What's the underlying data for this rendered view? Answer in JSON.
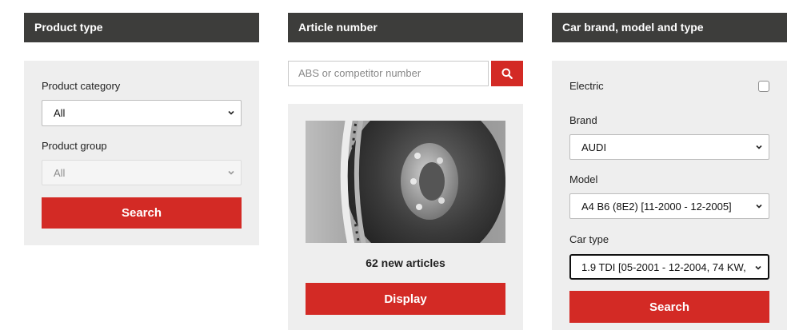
{
  "product_type": {
    "title": "Product type",
    "category_label": "Product category",
    "category_value": "All",
    "group_label": "Product group",
    "group_value": "All",
    "search_label": "Search"
  },
  "article_number": {
    "title": "Article number",
    "search_placeholder": "ABS or competitor number",
    "new_articles_text": "62 new articles",
    "display_label": "Display"
  },
  "car": {
    "title": "Car brand, model and type",
    "electric_label": "Electric",
    "electric_checked": false,
    "brand_label": "Brand",
    "brand_value": "AUDI",
    "model_label": "Model",
    "model_value": "A4 B6 (8E2) [11-2000 - 12-2005]",
    "type_label": "Car type",
    "type_value": "1.9 TDI [05-2001 - 12-2004, 74 KW,",
    "search_label": "Search"
  },
  "colors": {
    "header_bg": "#3d3d3b",
    "accent_red": "#d32a25",
    "panel_bg": "#eeeeee"
  },
  "icons": {
    "search": "search-icon",
    "chevron": "chevron-down-icon",
    "product_image": "brake-disc-image"
  }
}
